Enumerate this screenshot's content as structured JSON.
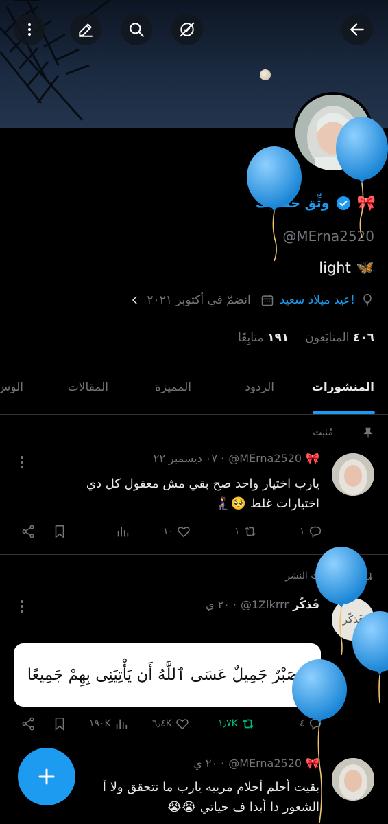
{
  "profile": {
    "verify_link": "وثِّق حسابك",
    "bow_emoji": "🎀",
    "handle": "@MErna2520",
    "bio_text": "light",
    "bio_emoji": "🦋",
    "birthday_text": "عيد ميلاد سعيد!",
    "joined_text": "انضمّ في أكتوبر ٢٠٢١",
    "followers_count": "٤٠٦",
    "followers_label": "المتابَعون",
    "following_count": "١٩١",
    "following_label": "متابِعًا"
  },
  "tabs": {
    "posts": "المنشورات",
    "replies": "الردود",
    "highlights": "المميزة",
    "articles": "المقالات",
    "media": "الوس"
  },
  "posts": [
    {
      "context": "مُثبت",
      "author_emoji": "🎀",
      "handle": "@MErna2520",
      "time": "٠٧ ديسمبر ٢٢ ·",
      "text_line1": "يارب اختيار واحد صح بقي مش معقول كل دي",
      "text_line2": "اختيارات غلط 🥺🧎‍♀️",
      "replies": "١",
      "reposts": "١",
      "likes": "١٠"
    },
    {
      "context": "أعدتَ النشر",
      "author_name": "فَذكّر",
      "handle": "@1Zikrrr",
      "time": "٢٠ ي ·",
      "quote_image_text": "فَصَبْرٌ جَمِيلٌ عَسَى ٱللَّهُ أَن يَأْتِيَنِى بِهِمْ جَمِيعًا",
      "replies": "٤",
      "reposts": "١٫٧K",
      "likes": "٦٫٤K",
      "views": "١٩٠K",
      "avatar_text": "فَذكّر"
    },
    {
      "author_emoji": "🎀",
      "handle": "@MErna2520",
      "time": "٢٠ ي ·",
      "text_line1": "بقيت أحلم أحلام مريبه يارب ما تتحقق ولا أ",
      "text_line2": "الشعور دا أبدا ف حياتي 😭😭"
    }
  ],
  "colors": {
    "accent": "#1d9bf0",
    "repost_active": "#00ba7c",
    "muted": "#71767b",
    "text": "#e7e9ea",
    "divider": "#2f3336"
  }
}
